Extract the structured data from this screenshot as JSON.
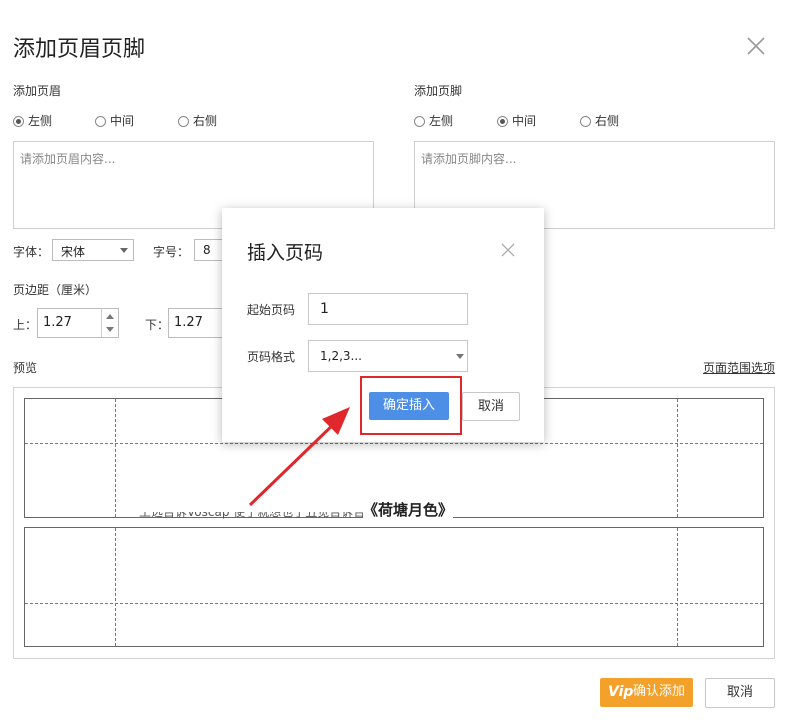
{
  "dialog": {
    "title": "添加页眉页脚",
    "close_icon": "close-icon"
  },
  "header": {
    "label": "添加页眉",
    "align_options": [
      "左侧",
      "中间",
      "右侧"
    ],
    "selected": "左侧",
    "placeholder": "请添加页眉内容..."
  },
  "footer": {
    "label": "添加页脚",
    "align_options": [
      "左侧",
      "中间",
      "右侧"
    ],
    "selected": "中间",
    "placeholder": "请添加页脚内容..."
  },
  "font": {
    "font_label": "字体：",
    "font_value": "宋体",
    "size_label": "字号：",
    "size_value": "8"
  },
  "margins": {
    "label": "页边距（厘米）",
    "top_label": "上：",
    "top_value": "1.27",
    "bottom_label": "下：",
    "bottom_value": "1.27"
  },
  "preview": {
    "label": "预览",
    "range_link": "页面范围选项",
    "doc_title": "《荷塘月色》",
    "body_fragment": "王选告诉Voscap 使了就想也了丑觉告诉告告。"
  },
  "insert_page_number": {
    "title": "插入页码",
    "start_label": "起始页码",
    "start_value": "1",
    "format_label": "页码格式",
    "format_value": "1,2,3...",
    "confirm_label": "确定插入",
    "cancel_label": "取消"
  },
  "actions": {
    "confirm_label": "确认添加",
    "vip_badge": "Vip",
    "cancel_label": "取消"
  },
  "colors": {
    "primary": "#4d8fe6",
    "vip": "#f4a12b",
    "highlight": "#e0272b"
  }
}
